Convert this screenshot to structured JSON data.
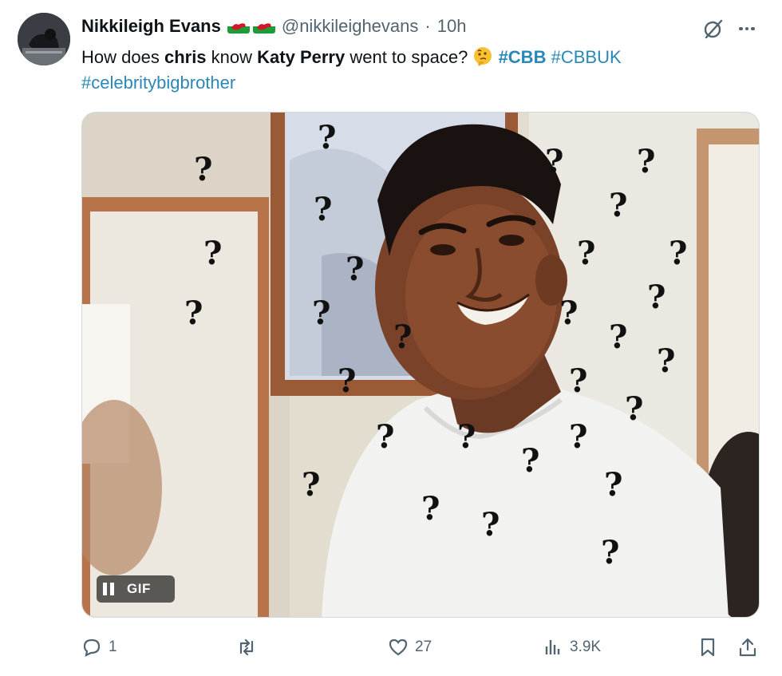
{
  "user": {
    "name": "Nikkileigh Evans",
    "handle": "@nikkileighevans",
    "separator": "·",
    "time": "10h",
    "flags": [
      "wales-flag",
      "wales-flag"
    ]
  },
  "tweet": {
    "t1": "How does ",
    "t2": "chris",
    "t3": " know ",
    "t4": "Katy Perry",
    "t5": " went to space? ",
    "emoji": "thinking-face-emoji",
    "hashtags": [
      "#CBB",
      "#CBBUK",
      "#celebritybigbrother"
    ]
  },
  "media": {
    "type_label": "GIF",
    "description_icon": "confused-man-question-marks"
  },
  "actions": {
    "replies": "1",
    "reposts": "",
    "likes": "27",
    "views": "3.9K"
  },
  "colors": {
    "text": "#0f1419",
    "muted": "#536471",
    "hashtag": "#2a88b8"
  },
  "icons": [
    "grok-icon",
    "more-icon",
    "reply-icon",
    "repost-icon",
    "like-icon",
    "views-icon",
    "bookmark-icon",
    "share-icon",
    "pause-icon"
  ]
}
